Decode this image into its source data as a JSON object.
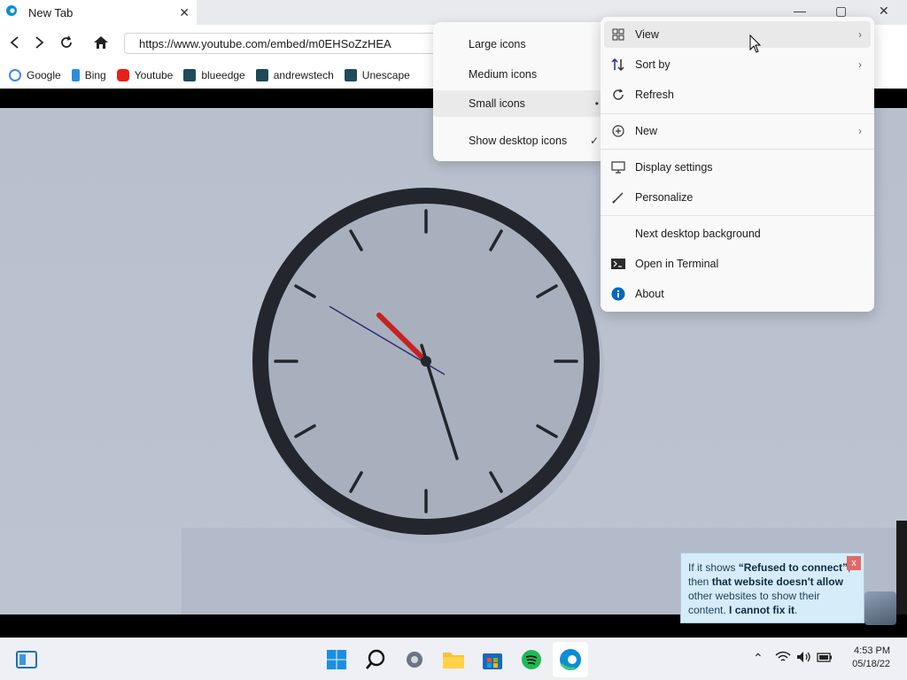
{
  "browser": {
    "tab_title": "New Tab",
    "url": "https://www.youtube.com/embed/m0EHSoZzHEA",
    "bookmarks": [
      {
        "label": "Google",
        "icon": "google-icon",
        "color": "#4285f4"
      },
      {
        "label": "Bing",
        "icon": "bing-icon",
        "color": "#2b8eda"
      },
      {
        "label": "Youtube",
        "icon": "youtube-icon",
        "color": "#e62117"
      },
      {
        "label": "blueedge",
        "icon": "react-icon",
        "color": "#1f4b5b"
      },
      {
        "label": "andrewstech",
        "icon": "andrewstech-icon",
        "color": "#1e4a55"
      },
      {
        "label": "Unescape",
        "icon": "react-icon",
        "color": "#1f4b5b"
      }
    ]
  },
  "view_submenu": {
    "items": [
      {
        "label": "Large icons",
        "mark": ""
      },
      {
        "label": "Medium icons",
        "mark": ""
      },
      {
        "label": "Small icons",
        "mark": "•"
      },
      {
        "label": "Show desktop icons",
        "mark": "✓"
      }
    ]
  },
  "context_menu": {
    "items": [
      {
        "label": "View",
        "icon": "grid-icon",
        "has_submenu": true
      },
      {
        "label": "Sort by",
        "icon": "sort-icon",
        "has_submenu": true
      },
      {
        "label": "Refresh",
        "icon": "refresh-icon",
        "has_submenu": false
      },
      {
        "label": "New",
        "icon": "plus-circle-icon",
        "has_submenu": true
      },
      {
        "label": "Display settings",
        "icon": "display-icon",
        "has_submenu": false
      },
      {
        "label": "Personalize",
        "icon": "pen-icon",
        "has_submenu": false
      },
      {
        "label": "Next desktop background",
        "icon": "",
        "has_submenu": false
      },
      {
        "label": "Open in Terminal",
        "icon": "terminal-icon",
        "has_submenu": false
      },
      {
        "label": "About",
        "icon": "info-icon",
        "has_submenu": false
      }
    ]
  },
  "tooltip": {
    "line1_pre": "If it shows ",
    "line1_bold": "“Refused to connect”",
    "line1_post": ",",
    "line2_pre": "then ",
    "line2_bold": "that website doesn't allow",
    "line3": "other websites to show their",
    "line4_pre": "content. ",
    "line4_bold": "I cannot fix it",
    "line4_post": ".",
    "close": "x"
  },
  "taskbar": {
    "time": "4:53 PM",
    "date": "05/18/22"
  },
  "colors": {
    "accent": "#0067c0",
    "edge": "#0c8dd8",
    "spotify": "#1db954"
  }
}
